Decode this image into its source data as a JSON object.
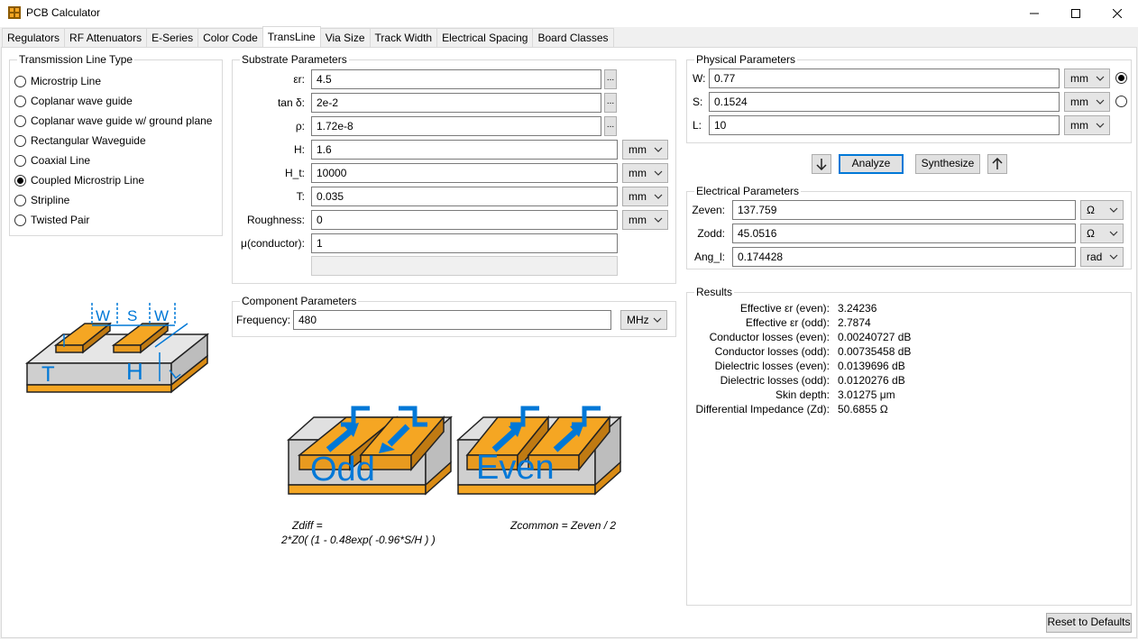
{
  "window": {
    "title": "PCB Calculator",
    "icon": "pcb-calculator-icon"
  },
  "tabs": [
    "Regulators",
    "RF Attenuators",
    "E-Series",
    "Color Code",
    "TransLine",
    "Via Size",
    "Track Width",
    "Electrical Spacing",
    "Board Classes"
  ],
  "active_tab": "TransLine",
  "line_type": {
    "title": "Transmission Line Type",
    "options": [
      "Microstrip Line",
      "Coplanar wave guide",
      "Coplanar wave guide w/ ground plane",
      "Rectangular Waveguide",
      "Coaxial Line",
      "Coupled Microstrip Line",
      "Stripline",
      "Twisted Pair"
    ],
    "selected": "Coupled Microstrip Line"
  },
  "diagram_labels": {
    "w1": "W",
    "s": "S",
    "w2": "W",
    "l": "L",
    "t": "T",
    "h": "H"
  },
  "substrate": {
    "title": "Substrate Parameters",
    "rows": [
      {
        "label": "εr:",
        "value": "4.5",
        "dots": "...",
        "unit": ""
      },
      {
        "label": "tan δ:",
        "value": "2e-2",
        "dots": "...",
        "unit": ""
      },
      {
        "label": "ρ:",
        "value": "1.72e-8",
        "dots": "...",
        "unit": ""
      },
      {
        "label": "H:",
        "value": "1.6",
        "dots": "",
        "unit": "mm"
      },
      {
        "label": "H_t:",
        "value": "10000",
        "dots": "",
        "unit": "mm"
      },
      {
        "label": "T:",
        "value": "0.035",
        "dots": "",
        "unit": "mm"
      },
      {
        "label": "Roughness:",
        "value": "0",
        "dots": "",
        "unit": "mm"
      },
      {
        "label": "μ(conductor):",
        "value": "1",
        "dots": "",
        "unit": ""
      }
    ]
  },
  "component": {
    "title": "Component Parameters",
    "label": "Frequency:",
    "value": "480",
    "unit": "MHz"
  },
  "modes": {
    "odd": "Odd",
    "even": "Even"
  },
  "formulas": {
    "zdiff_1": "Zdiff =",
    "zdiff_2": "2*Z0( (1 - 0.48exp( -0.96*S/H ) )",
    "zcommon": "Zcommon = Zeven / 2"
  },
  "physical": {
    "title": "Physical Parameters",
    "rows": [
      {
        "label": "W:",
        "value": "0.77",
        "unit": "mm",
        "radio": true,
        "checked": true
      },
      {
        "label": "S:",
        "value": "0.1524",
        "unit": "mm",
        "radio": true,
        "checked": false
      },
      {
        "label": "L:",
        "value": "10",
        "unit": "mm",
        "radio": false,
        "checked": false
      }
    ]
  },
  "actions": {
    "analyze": "Analyze",
    "synthesize": "Synthesize"
  },
  "electrical": {
    "title": "Electrical Parameters",
    "rows": [
      {
        "label": "Zeven:",
        "value": "137.759",
        "unit": "Ω"
      },
      {
        "label": "Zodd:",
        "value": "45.0516",
        "unit": "Ω"
      },
      {
        "label": "Ang_l:",
        "value": "0.174428",
        "unit": "rad"
      }
    ]
  },
  "results": {
    "title": "Results",
    "rows": [
      {
        "k": "Effective εr (even):",
        "v": "3.24236"
      },
      {
        "k": "Effective εr (odd):",
        "v": "2.7874"
      },
      {
        "k": "Conductor losses (even):",
        "v": "0.00240727 dB"
      },
      {
        "k": "Conductor losses (odd):",
        "v": "0.00735458 dB"
      },
      {
        "k": "Dielectric losses (even):",
        "v": "0.0139696 dB"
      },
      {
        "k": "Dielectric losses (odd):",
        "v": "0.0120276 dB"
      },
      {
        "k": "Skin depth:",
        "v": "3.01275 μm"
      },
      {
        "k": "Differential Impedance (Zd):",
        "v": "50.6855 Ω"
      }
    ]
  },
  "reset": "Reset to Defaults",
  "colors": {
    "accent": "#0078d7",
    "copper": "#f5a623",
    "copper_dark": "#b9741a",
    "dielectric": "#cfcfcf"
  }
}
